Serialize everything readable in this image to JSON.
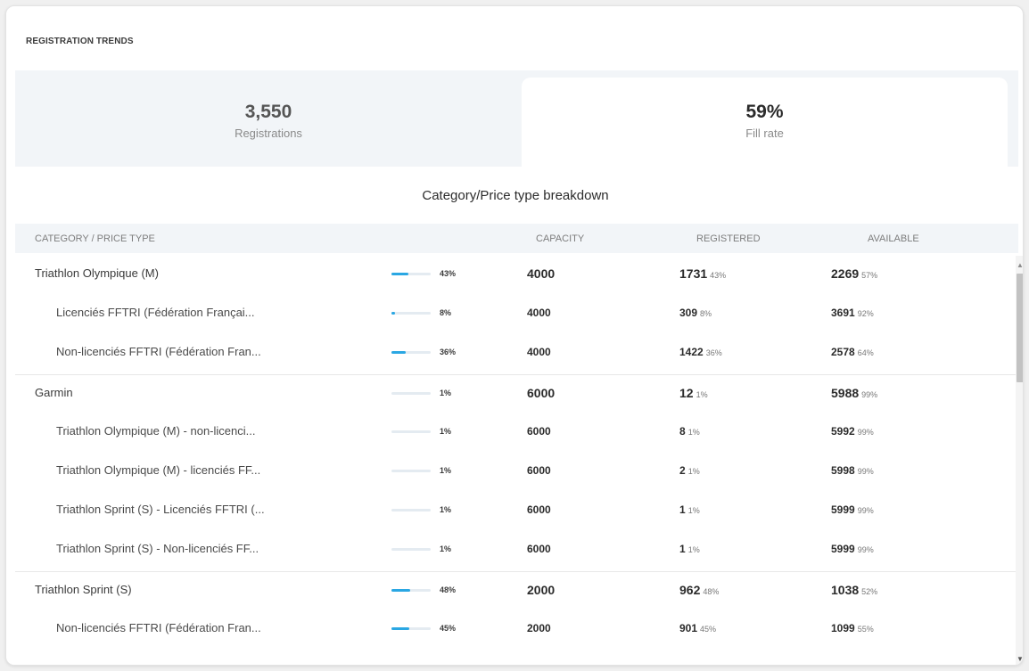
{
  "panel": {
    "title": "REGISTRATION TRENDS"
  },
  "kpis": [
    {
      "value": "3,550",
      "label": "Registrations"
    },
    {
      "value": "59%",
      "label": "Fill rate"
    }
  ],
  "breakdown": {
    "title": "Category/Price type breakdown",
    "columns": [
      "CATEGORY / PRICE TYPE",
      "CAPACITY",
      "REGISTERED",
      "AVAILABLE"
    ],
    "rows": [
      {
        "level": "parent",
        "name": "Triathlon Olympique (M)",
        "fill_pct": 43,
        "fill_label": "43%",
        "capacity": "4000",
        "registered": "1731",
        "registered_pct": "43%",
        "available": "2269",
        "available_pct": "57%"
      },
      {
        "level": "child",
        "name": "Licenciés FFTRI (Fédération Françai...",
        "fill_pct": 8,
        "fill_label": "8%",
        "capacity": "4000",
        "registered": "309",
        "registered_pct": "8%",
        "available": "3691",
        "available_pct": "92%"
      },
      {
        "level": "child",
        "name": "Non-licenciés FFTRI (Fédération Fran...",
        "fill_pct": 36,
        "fill_label": "36%",
        "capacity": "4000",
        "registered": "1422",
        "registered_pct": "36%",
        "available": "2578",
        "available_pct": "64%"
      },
      {
        "level": "parent",
        "name": "Garmin",
        "fill_pct": 1,
        "fill_label": "1%",
        "capacity": "6000",
        "registered": "12",
        "registered_pct": "1%",
        "available": "5988",
        "available_pct": "99%"
      },
      {
        "level": "child",
        "name": "Triathlon Olympique (M) - non-licenci...",
        "fill_pct": 1,
        "fill_label": "1%",
        "capacity": "6000",
        "registered": "8",
        "registered_pct": "1%",
        "available": "5992",
        "available_pct": "99%"
      },
      {
        "level": "child",
        "name": "Triathlon Olympique (M) - licenciés FF...",
        "fill_pct": 1,
        "fill_label": "1%",
        "capacity": "6000",
        "registered": "2",
        "registered_pct": "1%",
        "available": "5998",
        "available_pct": "99%"
      },
      {
        "level": "child",
        "name": "Triathlon Sprint (S) - Licenciés FFTRI (...",
        "fill_pct": 1,
        "fill_label": "1%",
        "capacity": "6000",
        "registered": "1",
        "registered_pct": "1%",
        "available": "5999",
        "available_pct": "99%"
      },
      {
        "level": "child",
        "name": "Triathlon Sprint (S) - Non-licenciés FF...",
        "fill_pct": 1,
        "fill_label": "1%",
        "capacity": "6000",
        "registered": "1",
        "registered_pct": "1%",
        "available": "5999",
        "available_pct": "99%"
      },
      {
        "level": "parent",
        "name": "Triathlon Sprint (S)",
        "fill_pct": 48,
        "fill_label": "48%",
        "capacity": "2000",
        "registered": "962",
        "registered_pct": "48%",
        "available": "1038",
        "available_pct": "52%"
      },
      {
        "level": "child",
        "name": "Non-licenciés FFTRI (Fédération Fran...",
        "fill_pct": 45,
        "fill_label": "45%",
        "capacity": "2000",
        "registered": "901",
        "registered_pct": "45%",
        "available": "1099",
        "available_pct": "55%"
      }
    ]
  },
  "scrollbar": {
    "up_icon": "scroll-up-arrow",
    "down_icon": "scroll-down-arrow"
  },
  "colors": {
    "accent": "#2aa7e3",
    "track": "#e4ebf1",
    "strip": "#f2f5f8"
  }
}
